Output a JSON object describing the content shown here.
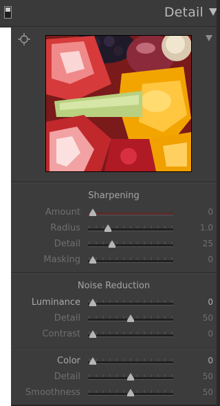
{
  "header": {
    "title": "Detail"
  },
  "sharpening": {
    "title": "Sharpening",
    "rows": [
      {
        "label": "Amount",
        "value": "0",
        "level": 0.0
      },
      {
        "label": "Radius",
        "value": "1.0",
        "level": 0.2
      },
      {
        "label": "Detail",
        "value": "25",
        "level": 0.25
      },
      {
        "label": "Masking",
        "value": "0",
        "level": 0.0
      }
    ]
  },
  "noise_reduction": {
    "title": "Noise Reduction",
    "rows": [
      {
        "label": "Luminance",
        "value": "0",
        "level": 0.0
      },
      {
        "label": "Detail",
        "value": "50",
        "level": 0.5
      },
      {
        "label": "Contrast",
        "value": "0",
        "level": 0.0
      },
      {
        "label": "Color",
        "value": "0",
        "level": 0.0
      },
      {
        "label": "Detail",
        "value": "50",
        "level": 0.5
      },
      {
        "label": "Smoothness",
        "value": "50",
        "level": 0.5
      }
    ]
  },
  "colors": {
    "panel_bg": "#3c3c3c",
    "amount_track": "#5a2a2a"
  },
  "icons": [
    "panel-switch-icon",
    "collapse-triangle-icon",
    "target-crosshair-icon",
    "preview-triangle-icon"
  ]
}
